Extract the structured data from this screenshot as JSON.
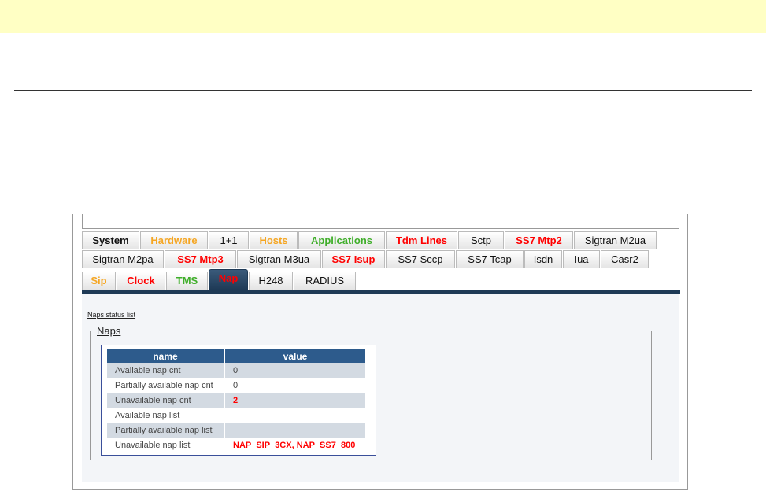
{
  "tabs": {
    "row1": [
      {
        "label": "System",
        "color": "#111111"
      },
      {
        "label": "Hardware",
        "color": "#f5a623"
      },
      {
        "label": "1+1",
        "color": "#111111"
      },
      {
        "label": "Hosts",
        "color": "#f5a623"
      },
      {
        "label": "Applications",
        "color": "#3fae2a"
      },
      {
        "label": "Tdm Lines",
        "color": "#ff0000"
      },
      {
        "label": "Sctp",
        "color": "#111111"
      },
      {
        "label": "SS7 Mtp2",
        "color": "#ff0000"
      },
      {
        "label": "Sigtran M2ua",
        "color": "#111111"
      }
    ],
    "row2": [
      {
        "label": "Sigtran M2pa"
      },
      {
        "label": "SS7 Mtp3"
      },
      {
        "label": "Sigtran M3ua"
      },
      {
        "label": "SS7 Isup"
      },
      {
        "label": "SS7 Sccp"
      },
      {
        "label": "SS7 Tcap"
      },
      {
        "label": "Isdn"
      },
      {
        "label": "Iua"
      },
      {
        "label": "Casr2"
      }
    ],
    "row3": [
      {
        "label": "Sip"
      },
      {
        "label": "Clock"
      },
      {
        "label": "TMS"
      },
      {
        "label": "Nap"
      },
      {
        "label": "H248"
      },
      {
        "label": "RADIUS"
      }
    ],
    "active": "Nap"
  },
  "content": {
    "status_link": "Naps status list",
    "group_title": "Naps",
    "columns": [
      "name",
      "value"
    ],
    "rows": [
      {
        "name": "Available nap cnt",
        "value": "0"
      },
      {
        "name": "Partially available nap cnt",
        "value": "0"
      },
      {
        "name": "Unavailable nap cnt",
        "value": "2"
      },
      {
        "name": "Available nap list",
        "value": ""
      },
      {
        "name": "Partially available nap list",
        "value": ""
      },
      {
        "name": "Unavailable nap list",
        "links": [
          "NAP_SIP_3CX",
          "NAP_SS7_800"
        ],
        "separator": ", "
      }
    ]
  }
}
